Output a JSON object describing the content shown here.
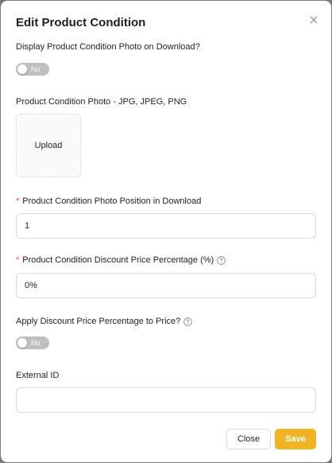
{
  "modal": {
    "title": "Edit Product Condition",
    "close_icon": "close-icon"
  },
  "display_photo": {
    "label": "Display Product Condition Photo on Download?",
    "toggle_label": "No",
    "toggle_on": false
  },
  "photo": {
    "label": "Product Condition Photo - JPG, JPEG, PNG",
    "upload_label": "Upload"
  },
  "photo_position": {
    "required_mark": "*",
    "label": "Product Condition Photo Position in Download",
    "value": "1"
  },
  "discount_percentage": {
    "required_mark": "*",
    "label": "Product Condition Discount Price Percentage (%)",
    "help_icon": "question-circle-icon",
    "value": "0%"
  },
  "apply_discount": {
    "label": "Apply Discount Price Percentage to Price?",
    "help_icon": "question-circle-icon",
    "toggle_label": "No",
    "toggle_on": false
  },
  "external_id": {
    "label": "External ID",
    "value": ""
  },
  "footer": {
    "close_label": "Close",
    "save_label": "Save"
  },
  "colors": {
    "accent": "#f0b323",
    "required": "#ff4d4f",
    "toggle_off": "#bfbfbf"
  }
}
